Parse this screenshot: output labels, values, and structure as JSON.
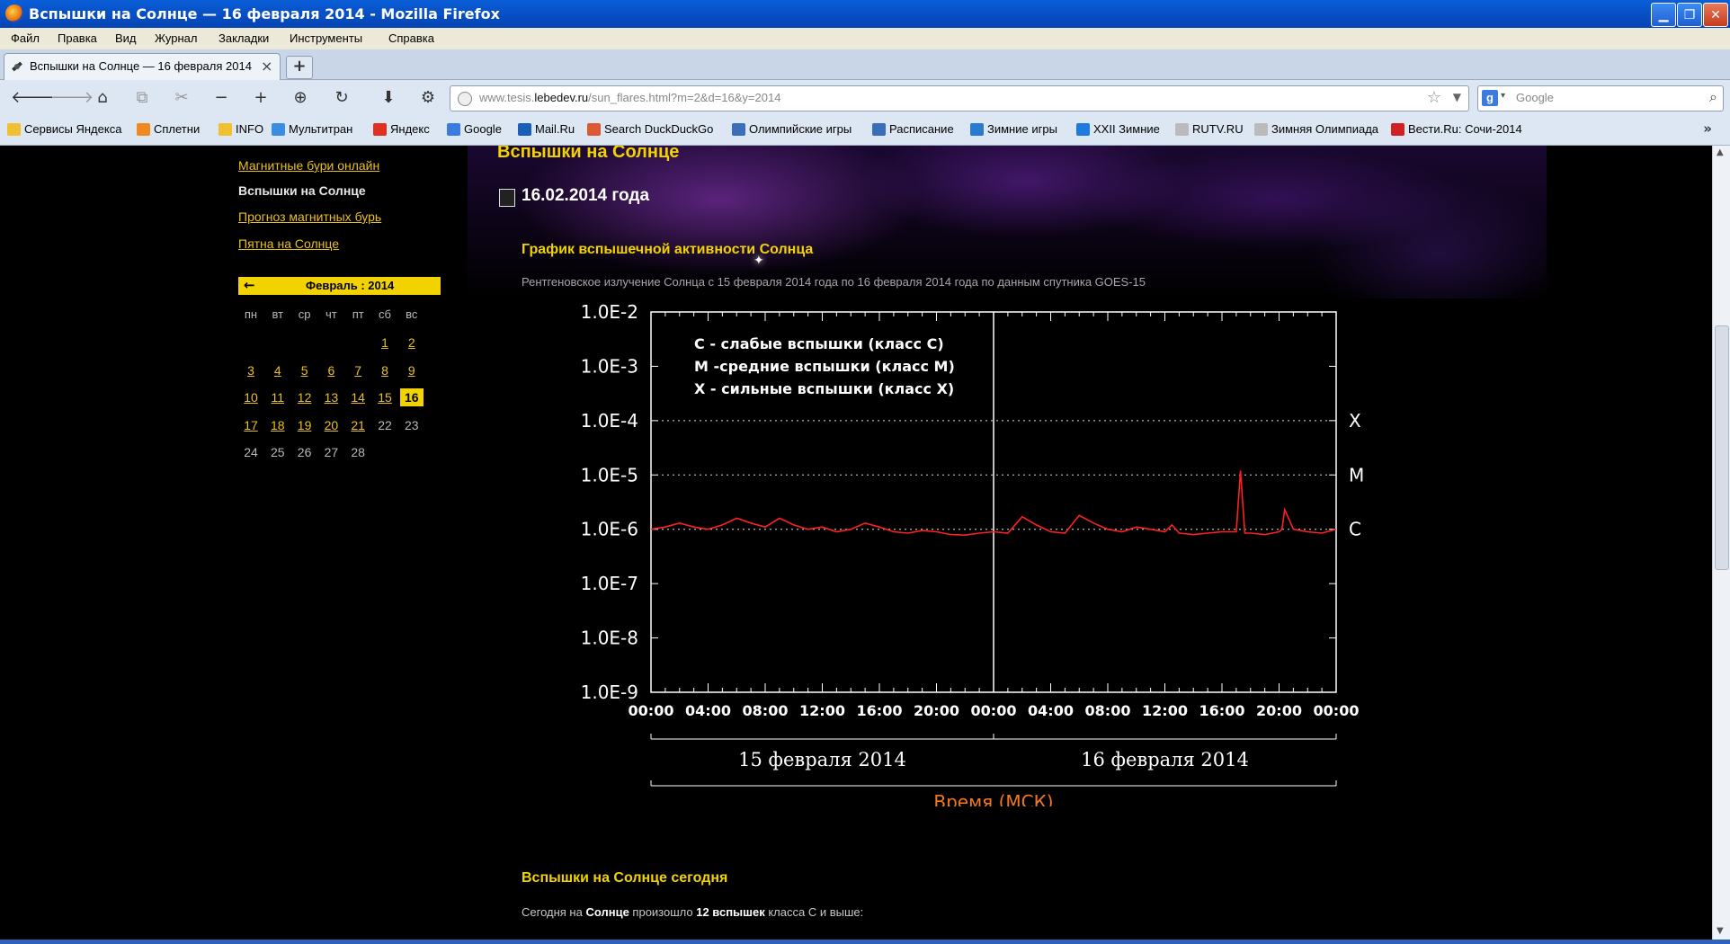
{
  "window": {
    "title": "Вспышки на Солнце — 16 февраля 2014 - Mozilla Firefox"
  },
  "menu": [
    "Файл",
    "Правка",
    "Вид",
    "Журнал",
    "Закладки",
    "Инструменты",
    "Справка"
  ],
  "tab": {
    "label": "Вспышки на Солнце — 16 февраля 2014",
    "close": "×",
    "new": "+"
  },
  "nav": {
    "url_prefix": "www.tesis.",
    "url_domain": "lebedev.ru",
    "url_path": "/sun_flares.html?m=2&d=16&y=2014",
    "search_placeholder": "Google",
    "search_engine": "g"
  },
  "bookmarks": [
    {
      "label": "Сервисы Яндекса",
      "icon": "folder-icon",
      "color": "#f0c030"
    },
    {
      "label": "Сплетни",
      "icon": "rss-icon",
      "color": "#f08a20"
    },
    {
      "label": "INFO",
      "icon": "folder-icon",
      "color": "#f0c030"
    },
    {
      "label": "Мультитран",
      "icon": "multitran-icon",
      "color": "#3a8ee0"
    },
    {
      "label": "Яндекс",
      "icon": "yandex-icon",
      "color": "#e03020"
    },
    {
      "label": "Google",
      "icon": "google-icon",
      "color": "#3b7be0"
    },
    {
      "label": "Mail.Ru",
      "icon": "mailru-icon",
      "color": "#1a5fb8"
    },
    {
      "label": "Search DuckDuckGo",
      "icon": "duckduckgo-icon",
      "color": "#de5833"
    },
    {
      "label": "Олимпийские игры",
      "icon": "olympic-icon",
      "color": "#3a6fb8"
    },
    {
      "label": "Расписание",
      "icon": "olympic-icon",
      "color": "#3a6fb8"
    },
    {
      "label": "Зимние игры",
      "icon": "snowflake-icon",
      "color": "#2a7ad0"
    },
    {
      "label": "XXII Зимние",
      "icon": "sochi-icon",
      "color": "#1f7ae0"
    },
    {
      "label": "RUTV.RU",
      "icon": "page-icon",
      "color": "#bbbbbb"
    },
    {
      "label": "Зимняя Олимпиада",
      "icon": "page-icon",
      "color": "#bbbbbb"
    },
    {
      "label": "Вести.Ru: Сочи-2014",
      "icon": "vesti-icon",
      "color": "#d02020"
    }
  ],
  "sidebar": {
    "links": [
      {
        "label": "Магнитные бури онлайн",
        "active": false
      },
      {
        "label": "Вспышки на Солнце",
        "active": true
      },
      {
        "label": "Прогноз магнитных бурь",
        "active": false
      },
      {
        "label": "Пятна на Солнце",
        "active": false
      }
    ],
    "calendar": {
      "arrow": "←",
      "month_label": "Февраль : 2014",
      "weekdays": [
        "пн",
        "вт",
        "ср",
        "чт",
        "пт",
        "сб",
        "вс"
      ],
      "first_weekday_index": 5,
      "days_in_month": 28,
      "linked_days": [
        1,
        2,
        3,
        4,
        5,
        6,
        7,
        8,
        9,
        10,
        11,
        12,
        13,
        14,
        15,
        17,
        18,
        19,
        20,
        21
      ],
      "today": 16
    }
  },
  "content": {
    "page_title": "Вспышки на Солнце",
    "date_line": "16.02.2014 года",
    "chart_heading": "График вспышечной активности Солнца",
    "chart_description": "Рентгеновское излучение Солнца с 15 февраля 2014 года по 16 февраля 2014 года по данным спутника GOES-15",
    "today_heading": "Вспышки на Солнце сегодня",
    "today_text": {
      "p1": "Сегодня на ",
      "b1": "Солнце",
      "p2": " произошло ",
      "b2": "12 вспышек",
      "p3": " класса С и выше:"
    }
  },
  "chart_data": {
    "type": "line",
    "y_scale": "log",
    "ylim": [
      1e-09,
      0.01
    ],
    "ytick_labels": [
      "1.0E-2",
      "1.0E-3",
      "1.0E-4",
      "1.0E-5",
      "1.0E-6",
      "1.0E-7",
      "1.0E-8",
      "1.0E-9"
    ],
    "xtick_labels": [
      "00:00",
      "04:00",
      "08:00",
      "12:00",
      "16:00",
      "20:00",
      "00:00",
      "04:00",
      "08:00",
      "12:00",
      "16:00",
      "20:00",
      "00:00"
    ],
    "x_hours_range": [
      0,
      48
    ],
    "day_labels": [
      "15 февраля 2014",
      "16 февраля 2014"
    ],
    "xlabel": "Время (МСК)",
    "legend": [
      "C - слабые вспышки (класс C)",
      "M -средние вспышки (класс M)",
      "X - сильные вспышки (класс X)"
    ],
    "class_levels": [
      {
        "label": "X",
        "value": 0.0001
      },
      {
        "label": "M",
        "value": 1e-05
      },
      {
        "label": "C",
        "value": 1e-06
      }
    ],
    "series": [
      {
        "color": "#ff2020",
        "hours": [
          0,
          1,
          2,
          3,
          4,
          5,
          6,
          7,
          8,
          9,
          10,
          11,
          12,
          13,
          14,
          15,
          16,
          17,
          18,
          19,
          20,
          21,
          22,
          23,
          24,
          25,
          26,
          27,
          28,
          29,
          30,
          31,
          32,
          33,
          34,
          35,
          36,
          36.5,
          37,
          38,
          39,
          40,
          41,
          41.3,
          41.6,
          42,
          43,
          44,
          44.2,
          44.4,
          45,
          46,
          47,
          48
        ],
        "values": [
          1e-06,
          1.1e-06,
          1.3e-06,
          1.1e-06,
          1e-06,
          1.2e-06,
          1.6e-06,
          1.3e-06,
          1.1e-06,
          1.6e-06,
          1.2e-06,
          1e-06,
          1.1e-06,
          9e-07,
          1e-06,
          1.3e-06,
          1.1e-06,
          9e-07,
          8.5e-07,
          9.5e-07,
          9e-07,
          8e-07,
          7.8e-07,
          8.5e-07,
          9e-07,
          8.5e-07,
          1.7e-06,
          1.2e-06,
          9e-07,
          8.5e-07,
          1.8e-06,
          1.3e-06,
          1e-06,
          9e-07,
          1.1e-06,
          1e-06,
          9e-07,
          1.2e-06,
          8.5e-07,
          8e-07,
          8.5e-07,
          9e-07,
          9e-07,
          1.2e-05,
          8.5e-07,
          8.5e-07,
          8e-07,
          9e-07,
          1e-06,
          2.3e-06,
          1e-06,
          9e-07,
          8.5e-07,
          1e-06
        ]
      }
    ]
  }
}
